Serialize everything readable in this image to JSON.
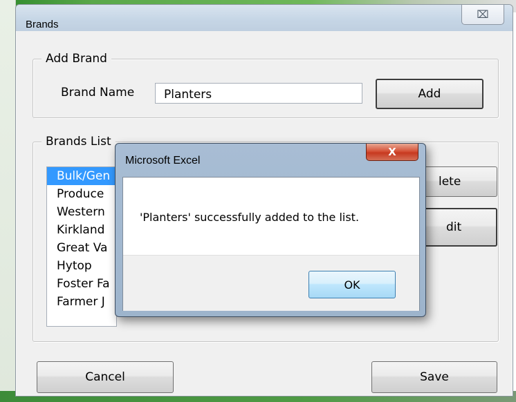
{
  "brands_dialog": {
    "title": "Brands",
    "close_glyph": "⌧",
    "add_group": {
      "legend": "Add Brand",
      "brand_name_label": "Brand Name",
      "brand_name_value": "Planters",
      "add_button": "Add"
    },
    "list_group": {
      "legend": "Brands List",
      "items": [
        "Bulk/Gen",
        "Produce",
        "Western",
        "Kirkland",
        "Great Va",
        "Hytop",
        "Foster Fa",
        "Farmer J"
      ],
      "selected_index": 0,
      "delete_button_partial": "lete",
      "edit_button_partial": "dit"
    },
    "cancel_button": "Cancel",
    "save_button": "Save"
  },
  "message_box": {
    "title": "Microsoft Excel",
    "close_glyph": "X",
    "message": "'Planters' successfully added to the list.",
    "ok_button": "OK"
  },
  "colors": {
    "selection": "#3399ff",
    "close_button_red": "#c7391f"
  }
}
